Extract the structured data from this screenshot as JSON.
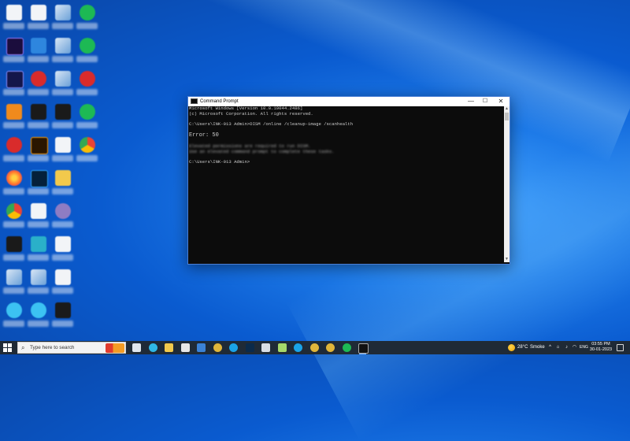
{
  "colors": {
    "desktop_bg": "#0a5bd0",
    "taskbar_bg": "#1f2a36",
    "terminal_bg": "#0c0c0c",
    "terminal_fg": "#cccccc",
    "window_border": "#4a7fd6"
  },
  "desktop_icons": [
    {
      "icon": "document-icon",
      "style": "doc"
    },
    {
      "icon": "document-icon",
      "style": "doc"
    },
    {
      "icon": "mixed-icon",
      "style": "mixed"
    },
    {
      "icon": "shield-icon",
      "style": "green"
    },
    {
      "icon": "after-effects-icon",
      "style": "ae"
    },
    {
      "icon": "app-icon",
      "style": "blue"
    },
    {
      "icon": "image-icon",
      "style": "mixed"
    },
    {
      "icon": "spotify-icon",
      "style": "green"
    },
    {
      "icon": "media-encoder-icon",
      "style": "me"
    },
    {
      "icon": "app-icon",
      "style": "red"
    },
    {
      "icon": "image-icon",
      "style": "mixed"
    },
    {
      "icon": "app-icon",
      "style": "red"
    },
    {
      "icon": "vlc-icon",
      "style": "orange"
    },
    {
      "icon": "premiere-icon",
      "style": "dark"
    },
    {
      "icon": "image-icon",
      "style": "dark"
    },
    {
      "icon": "app-icon",
      "style": "green"
    },
    {
      "icon": "app-icon",
      "style": "red"
    },
    {
      "icon": "illustrator-icon",
      "style": "ai"
    },
    {
      "icon": "document-icon",
      "style": "doc"
    },
    {
      "icon": "chrome-icon",
      "style": "chrome"
    },
    {
      "icon": "firefox-icon",
      "style": "firefox"
    },
    {
      "icon": "photoshop-icon",
      "style": "ps"
    },
    {
      "icon": "folder-icon",
      "style": "yellow"
    },
    null,
    {
      "icon": "chrome-icon",
      "style": "chrome"
    },
    {
      "icon": "document-icon",
      "style": "doc"
    },
    {
      "icon": "app-icon",
      "style": "purple"
    },
    null,
    {
      "icon": "app-icon",
      "style": "dark"
    },
    {
      "icon": "app-icon",
      "style": "teal"
    },
    {
      "icon": "document-icon",
      "style": "doc"
    },
    null,
    {
      "icon": "document-icon",
      "style": "mixed"
    },
    {
      "icon": "image-icon",
      "style": "mixed"
    },
    {
      "icon": "document-icon",
      "style": "doc"
    },
    null,
    {
      "icon": "edge-icon",
      "style": "cyan"
    },
    {
      "icon": "app-icon",
      "style": "cyan"
    },
    {
      "icon": "app-icon",
      "style": "dark"
    },
    null
  ],
  "window": {
    "title": "Command Prompt",
    "minimize": "—",
    "maximize": "☐",
    "close": "✕",
    "lines": [
      {
        "text": "Microsoft Windows [Version 10.0.19044.2486]",
        "kind": "normal"
      },
      {
        "text": "(c) Microsoft Corporation. All rights reserved.",
        "kind": "normal"
      },
      {
        "text": "",
        "kind": "normal"
      },
      {
        "text": "C:\\Users\\INK-013 Admin>DISM /online /cleanup-image /scanhealth",
        "kind": "normal"
      },
      {
        "text": "",
        "kind": "normal"
      },
      {
        "text": "Error: 50",
        "kind": "err"
      },
      {
        "text": "",
        "kind": "normal"
      },
      {
        "text": "Elevated permissions are required to run DISM.",
        "kind": "blur"
      },
      {
        "text": "Use an elevated command prompt to complete these tasks.",
        "kind": "blur"
      },
      {
        "text": "",
        "kind": "normal"
      },
      {
        "text": "C:\\Users\\INK-013 Admin>",
        "kind": "normal"
      }
    ]
  },
  "taskbar": {
    "search_placeholder": "Type here to search",
    "pinned": [
      {
        "icon": "task-view-icon",
        "color": "#dfe6ee",
        "active": false
      },
      {
        "icon": "edge-icon",
        "color": "#2fb8e6",
        "active": false
      },
      {
        "icon": "file-explorer-icon",
        "color": "#f2c94c",
        "active": false
      },
      {
        "icon": "store-icon",
        "color": "#e7e7e7",
        "active": false
      },
      {
        "icon": "mail-icon",
        "color": "#3b82d6",
        "active": false
      },
      {
        "icon": "chrome-icon",
        "color": "#e0b53a",
        "active": false
      },
      {
        "icon": "skype-icon",
        "color": "#1aa3e8",
        "active": false
      },
      {
        "icon": "photoshop-icon",
        "color": "#0b2a4a",
        "active": false
      },
      {
        "icon": "files-icon",
        "color": "#d9dee5",
        "active": false
      },
      {
        "icon": "notepad-icon",
        "color": "#a6d86a",
        "active": false
      },
      {
        "icon": "skype-icon",
        "color": "#1aa3e8",
        "active": false
      },
      {
        "icon": "chrome-icon",
        "color": "#e0b53a",
        "active": false
      },
      {
        "icon": "chrome-icon",
        "color": "#e0b53a",
        "active": false
      },
      {
        "icon": "spotify-icon",
        "color": "#1db954",
        "active": false
      },
      {
        "icon": "command-prompt-icon",
        "color": "#111111",
        "active": true
      }
    ],
    "weather_temp": "28°C",
    "weather_text": "Smoke",
    "language": "ENG",
    "time": "03:55 PM",
    "date": "30-01-2023"
  }
}
